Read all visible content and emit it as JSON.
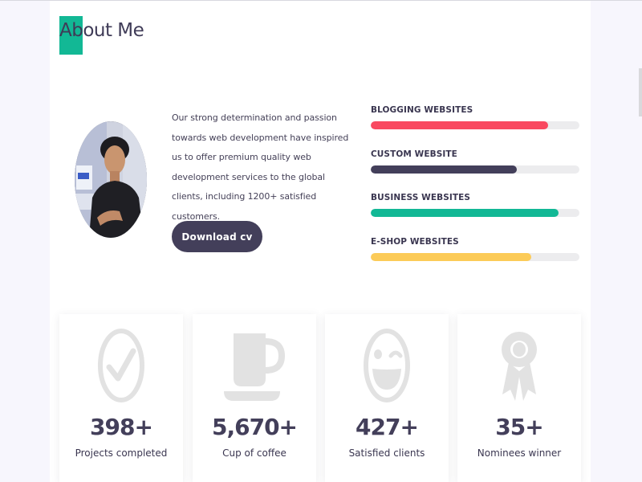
{
  "section": {
    "title": "About Me"
  },
  "intro": {
    "text": "Our strong determination and passion towards web development have inspired us to offer premium quality web development services to the global clients, including 1200+ satisfied customers."
  },
  "cv_button": {
    "label": "Download cv"
  },
  "skills": [
    {
      "label": "BLOGGING WEBSITES",
      "level": 0.85,
      "color": "#f94860"
    },
    {
      "label": "CUSTOM WEBSITE",
      "level": 0.7,
      "color": "#433f5a"
    },
    {
      "label": "BUSINESS WEBSITES",
      "level": 0.9,
      "color": "#12b895"
    },
    {
      "label": "E-SHOP WEBSITES",
      "level": 0.77,
      "color": "#fccb58"
    }
  ],
  "stats": [
    {
      "value": "398+",
      "label": "Projects completed",
      "icon": "check-circle-icon"
    },
    {
      "value": "5,670+",
      "label": "Cup of coffee",
      "icon": "coffee-cup-icon"
    },
    {
      "value": "427+",
      "label": "Satisfied clients",
      "icon": "wink-smile-icon"
    },
    {
      "value": "35+",
      "label": "Nominees winner",
      "icon": "award-ribbon-icon"
    }
  ],
  "colors": {
    "accent": "#12b895",
    "dark": "#433f5a",
    "icon_gray": "#e2e2e2"
  }
}
